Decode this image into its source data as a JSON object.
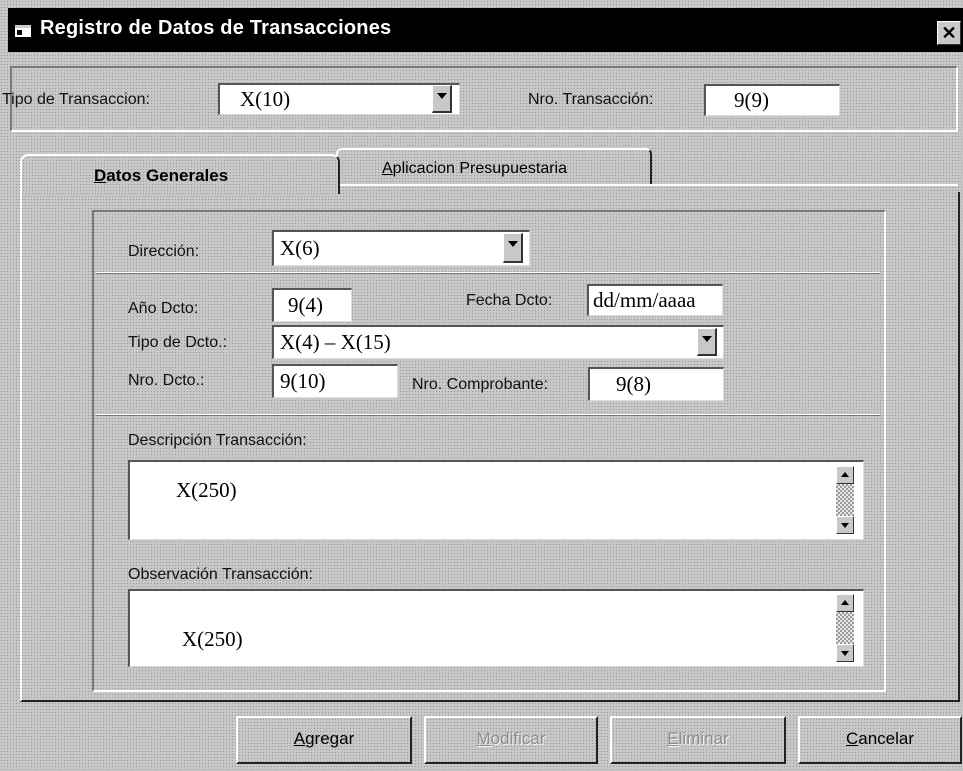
{
  "window": {
    "title": "Registro de Datos de Transacciones",
    "close_glyph": "✕"
  },
  "header": {
    "tipo_transaccion_label": "Tipo de Transaccion:",
    "tipo_transaccion_value": "X(10)",
    "nro_transaccion_label": "Nro. Transacción:",
    "nro_transaccion_value": "9(9)"
  },
  "tabs": [
    {
      "label": "Datos Generales",
      "accel": "D",
      "rest": "atos Generales",
      "active": true
    },
    {
      "label": "Aplicacion Presupuestaria",
      "accel": "A",
      "rest": "plicacion Presupuestaria",
      "active": false
    }
  ],
  "form": {
    "direccion_label": "Dirección:",
    "direccion_value": "X(6)",
    "anio_label": "Año Dcto:",
    "anio_value": "9(4)",
    "fecha_label": "Fecha Dcto:",
    "fecha_value": "dd/mm/aaaa",
    "tipo_dcto_label": "Tipo de Dcto.:",
    "tipo_dcto_value": "X(4) – X(15)",
    "nro_dcto_label": "Nro. Dcto.:",
    "nro_dcto_value": "9(10)",
    "nro_comprobante_label": "Nro. Comprobante:",
    "nro_comprobante_value": "9(8)",
    "descripcion_label": "Descripción Transacción:",
    "descripcion_value": "X(250)",
    "observacion_label": "Observación Transacción:",
    "observacion_value": "X(250)"
  },
  "buttons": [
    {
      "label": "Agregar",
      "accel": "A",
      "rest": "gregar",
      "enabled": true
    },
    {
      "label": "Modificar",
      "accel": "M",
      "rest": "odificar",
      "enabled": false
    },
    {
      "label": "Eliminar",
      "accel": "E",
      "rest": "liminar",
      "enabled": false
    },
    {
      "label": "Cancelar",
      "accel": "C",
      "rest": "ancelar",
      "enabled": true
    }
  ],
  "icons": [
    "window-icon",
    "close-icon",
    "dropdown-arrow-icon",
    "scroll-up-icon",
    "scroll-down-icon"
  ]
}
